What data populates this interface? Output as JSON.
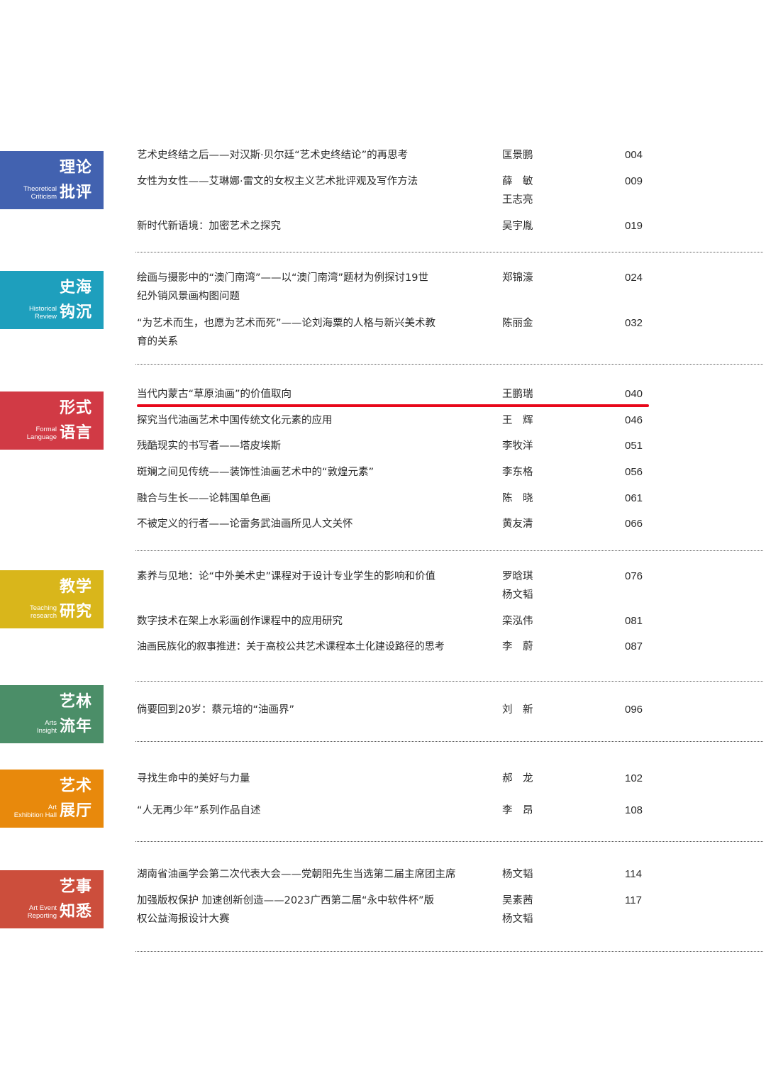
{
  "sections": [
    {
      "cn1": "理论",
      "cn2": "批评",
      "en1": "Theoretical",
      "en2": "Criticism",
      "color": "#4262b0",
      "entries": [
        {
          "title": "艺术史终结之后——对汉斯·贝尔廷“艺术史终结论”的再思考",
          "author": "匡景鹏",
          "page": "004"
        },
        {
          "title": "女性为女性——艾琳娜·雷文的女权主义艺术批评观及写作方法",
          "author": "薛　敏",
          "author2": "王志亮",
          "page": "009"
        },
        {
          "title": "新时代新语境：加密艺术之探究",
          "author": "吴宇胤",
          "page": "019"
        }
      ]
    },
    {
      "cn1": "史海",
      "cn2": "钩沉",
      "en1": "Historical",
      "en2": "Review",
      "color": "#1e9fbd",
      "entries": [
        {
          "title": "绘画与摄影中的“澳门南湾”——以“澳门南湾”题材为例探讨19世",
          "title2": "纪外销风景画构图问题",
          "author": "郑锦濠",
          "page": "024"
        },
        {
          "title": "“为艺术而生，也愿为艺术而死”——论刘海粟的人格与新兴美术教",
          "title2": "育的关系",
          "author": "陈丽金",
          "page": "032"
        }
      ]
    },
    {
      "cn1": "形式",
      "cn2": "语言",
      "en1": "Formal",
      "en2": "Language",
      "color": "#d13a45",
      "entries": [
        {
          "title": "当代内蒙古“草原油画”的价值取向",
          "author": "王鹏瑞",
          "page": "040"
        },
        {
          "title": "探究当代油画艺术中国传统文化元素的应用",
          "author": "王　辉",
          "page": "046"
        },
        {
          "title": "残酷现实的书写者——塔皮埃斯",
          "author": "李牧洋",
          "page": "051"
        },
        {
          "title": "斑斓之间见传统——装饰性油画艺术中的“敦煌元素”",
          "author": "李东格",
          "page": "056"
        },
        {
          "title": "融合与生长——论韩国单色画",
          "author": "陈　晓",
          "page": "061"
        },
        {
          "title": "不被定义的行者——论雷务武油画所见人文关怀",
          "author": "黄友清",
          "page": "066"
        }
      ]
    },
    {
      "cn1": "教学",
      "cn2": "研究",
      "en1": "Teaching",
      "en2": "research",
      "color": "#d9b61b",
      "entries": [
        {
          "title": "素养与见地：论“中外美术史”课程对于设计专业学生的影响和价值",
          "author": "罗晗琪",
          "author2": "杨文韬",
          "page": "076"
        },
        {
          "title": "数字技术在架上水彩画创作课程中的应用研究",
          "author": "栾泓伟",
          "page": "081"
        },
        {
          "title": "油画民族化的叙事推进：关于高校公共艺术课程本土化建设路径的思考",
          "author": "李　蔚",
          "page": "087"
        }
      ]
    },
    {
      "cn1": "艺林",
      "cn2": "流年",
      "en1": "Arts",
      "en2": "Insight",
      "color": "#4b8e68",
      "entries": [
        {
          "title": "倘要回到20岁：蔡元培的“油画界”",
          "author": "刘　新",
          "page": "096"
        }
      ]
    },
    {
      "cn1": "艺术",
      "cn2": "展厅",
      "en1": "Art",
      "en2": "Exhibition Hall",
      "color": "#e8890c",
      "entries": [
        {
          "title": "寻找生命中的美好与力量",
          "author": "郝　龙",
          "page": "102"
        },
        {
          "title": "“人无再少年”系列作品自述",
          "author": "李　昂",
          "page": "108"
        }
      ]
    },
    {
      "cn1": "艺事",
      "cn2": "知悉",
      "en1": "Art Event",
      "en2": "Reporting",
      "color": "#cc4e3c",
      "entries": [
        {
          "title": "湖南省油画学会第二次代表大会——党朝阳先生当选第二届主席团主席",
          "author": "杨文韬",
          "page": "114"
        },
        {
          "title": "加强版权保护 加速创新创造——2023广西第二届“永中软件杯”版",
          "title2": "权公益海报设计大赛",
          "author": "吴素茜",
          "author2": "杨文韬",
          "page": "117"
        }
      ]
    }
  ]
}
